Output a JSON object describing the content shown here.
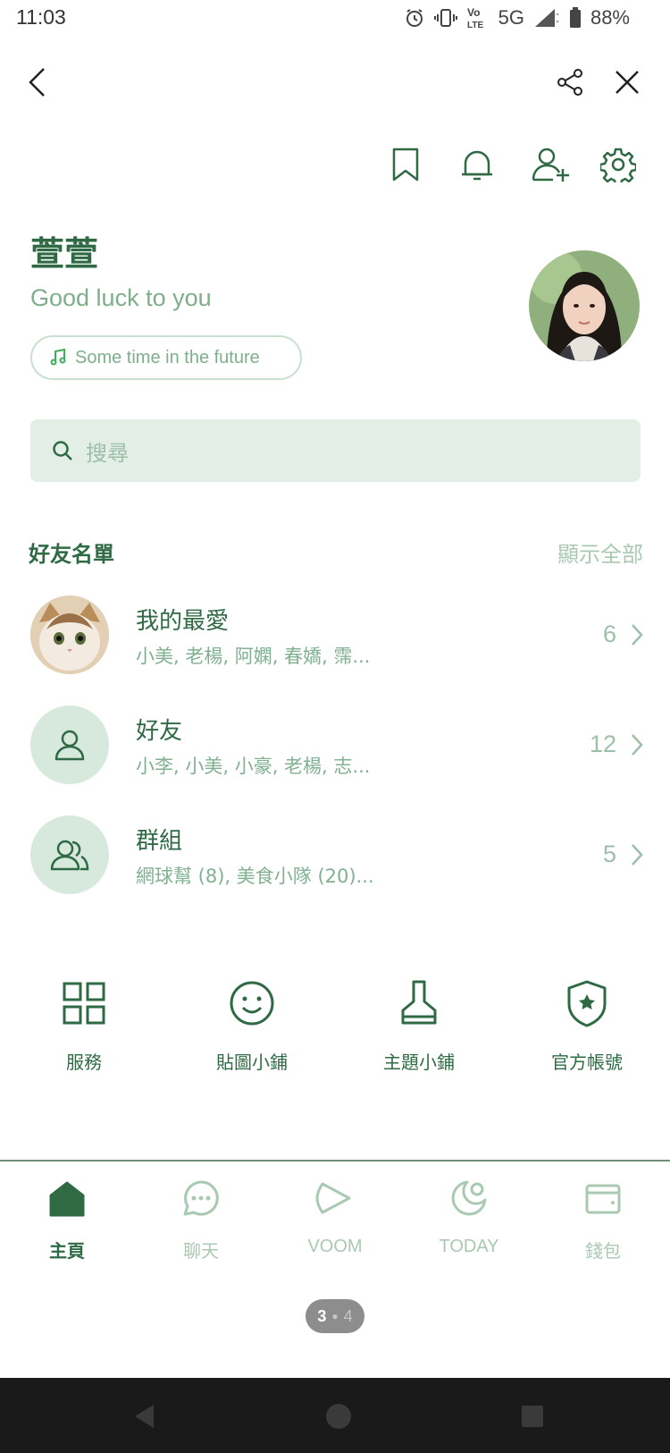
{
  "status_bar": {
    "time": "11:03",
    "network": "5G",
    "battery": "88%"
  },
  "profile": {
    "name": "萱萱",
    "status_message": "Good luck to you",
    "music": "Some time in the future"
  },
  "search": {
    "placeholder": "搜尋"
  },
  "friends_section": {
    "title": "好友名單",
    "show_all": "顯示全部",
    "rows": [
      {
        "name": "我的最愛",
        "members": "小美, 老楊, 阿嫻, 春嬌, 霈...",
        "count": "6"
      },
      {
        "name": "好友",
        "members": "小李, 小美, 小豪, 老楊, 志...",
        "count": "12"
      },
      {
        "name": "群組",
        "members": "網球幫 (8), 美食小隊 (20)...",
        "count": "5"
      }
    ]
  },
  "shortcuts": [
    {
      "label": "服務",
      "icon": "grid-icon"
    },
    {
      "label": "貼圖小鋪",
      "icon": "smiley-icon"
    },
    {
      "label": "主題小鋪",
      "icon": "brush-icon"
    },
    {
      "label": "官方帳號",
      "icon": "shield-star-icon"
    }
  ],
  "tabs": [
    {
      "label": "主頁",
      "icon": "home-icon",
      "active": true
    },
    {
      "label": "聊天",
      "icon": "chat-icon",
      "active": false
    },
    {
      "label": "VOOM",
      "icon": "voom-icon",
      "active": false
    },
    {
      "label": "TODAY",
      "icon": "today-icon",
      "active": false
    },
    {
      "label": "錢包",
      "icon": "wallet-icon",
      "active": false
    }
  ],
  "page_indicator": {
    "current": "3",
    "total": "4"
  },
  "colors": {
    "accent": "#2f6a45",
    "muted": "#a9c9b3",
    "search_bg": "#e3eee6"
  }
}
